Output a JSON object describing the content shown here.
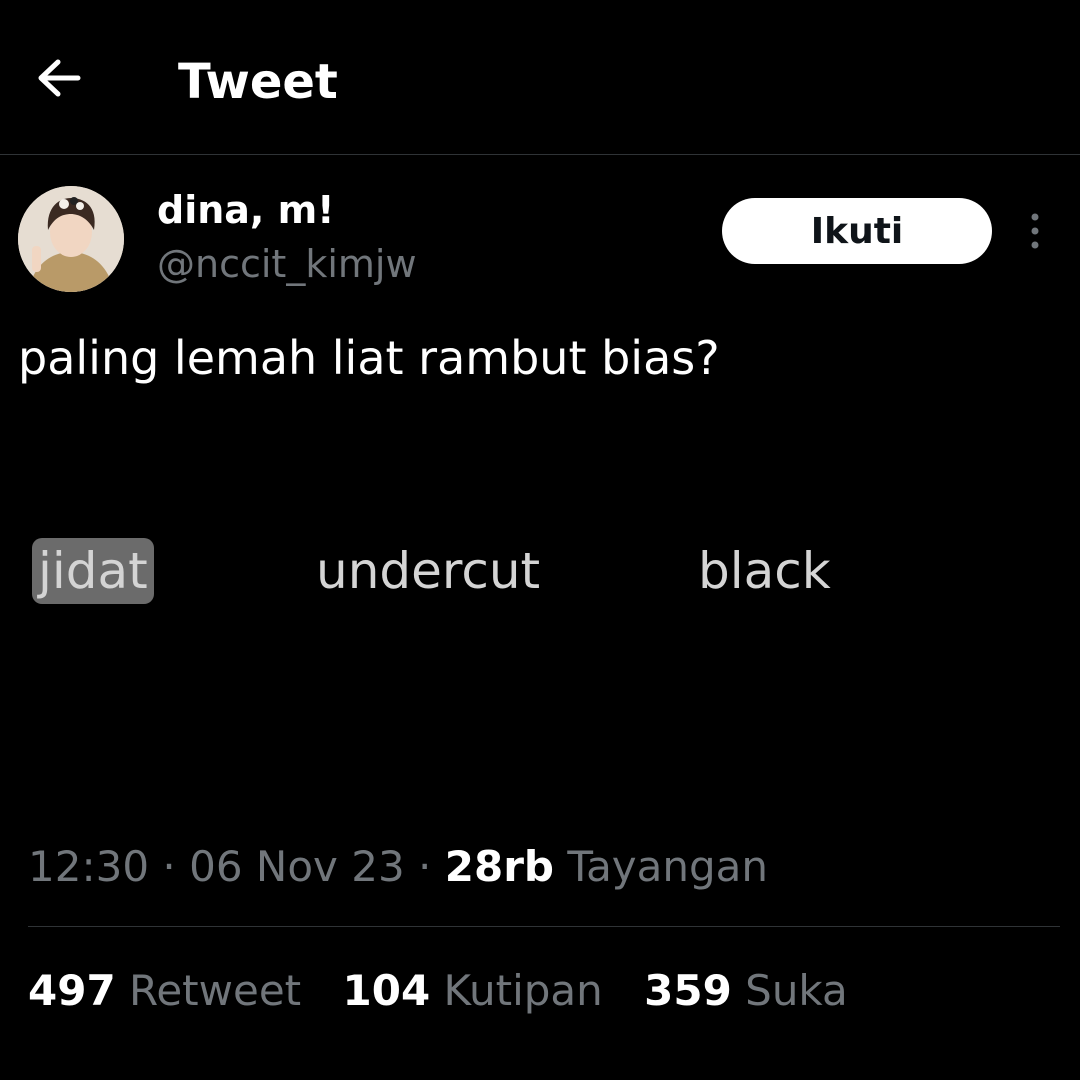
{
  "header": {
    "back_icon": "arrow-left-icon",
    "title": "Tweet"
  },
  "author": {
    "display_name": "dina, m!",
    "handle": "@nccit_kimjw",
    "avatar_icon": "profile-photo",
    "follow_label": "Ikuti",
    "more_icon": "vertical-ellipsis-icon"
  },
  "tweet": {
    "text": "paling lemah liat rambut bias?",
    "options": [
      {
        "label": "jidat",
        "selected": true
      },
      {
        "label": "undercut",
        "selected": false
      },
      {
        "label": "black",
        "selected": false
      }
    ]
  },
  "meta": {
    "time": "12:30",
    "separator": "·",
    "date": "06 Nov 23",
    "views_count": "28rb",
    "views_label": "Tayangan"
  },
  "stats": {
    "retweets_count": "497",
    "retweets_label": "Retweet",
    "quotes_count": "104",
    "quotes_label": "Kutipan",
    "likes_count": "359",
    "likes_label": "Suka"
  },
  "colors": {
    "background": "#000000",
    "primary_text": "#ffffff",
    "secondary_text": "#71767b",
    "divider": "#2f3336",
    "selection_highlight": "#6b6b6b"
  }
}
